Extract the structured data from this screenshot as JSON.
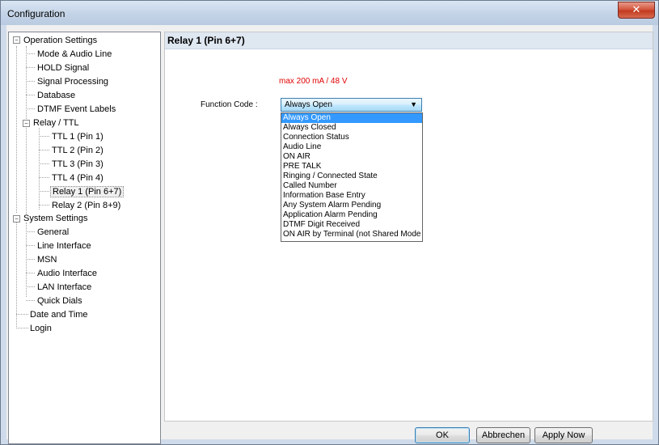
{
  "window": {
    "title": "Configuration",
    "close_glyph": "✕"
  },
  "tree": {
    "operation_settings": "Operation Settings",
    "mode_audio_line": "Mode & Audio Line",
    "hold_signal": "HOLD Signal",
    "signal_processing": "Signal Processing",
    "database": "Database",
    "dtmf_event_labels": "DTMF Event Labels",
    "relay_ttl": "Relay / TTL",
    "ttl1": "TTL 1 (Pin 1)",
    "ttl2": "TTL 2 (Pin 2)",
    "ttl3": "TTL 3 (Pin 3)",
    "ttl4": "TTL 4 (Pin 4)",
    "relay1": "Relay 1 (Pin 6+7)",
    "relay2": "Relay 2 (Pin 8+9)",
    "system_settings": "System Settings",
    "general": "General",
    "line_interface": "Line Interface",
    "msn": "MSN",
    "audio_interface": "Audio Interface",
    "lan_interface": "LAN Interface",
    "quick_dials": "Quick Dials",
    "date_time": "Date and Time",
    "login": "Login",
    "expander_open": "−"
  },
  "panel": {
    "title": "Relay 1 (Pin 6+7)",
    "max_text": "max 200 mA / 48 V",
    "function_code_label": "Function Code :",
    "function_code_value": "Always Open",
    "options": [
      "Always Open",
      "Always Closed",
      "Connection Status",
      "Audio Line",
      "ON AIR",
      "PRE TALK",
      "Ringing / Connected State",
      "Called Number",
      "Information Base Entry",
      "Any System Alarm Pending",
      "Application Alarm Pending",
      "DTMF Digit Received",
      "ON AIR by Terminal (not Shared Mode"
    ],
    "combo_arrow": "▼"
  },
  "buttons": {
    "ok": "OK",
    "cancel": "Abbrechen",
    "apply": "Apply Now"
  }
}
